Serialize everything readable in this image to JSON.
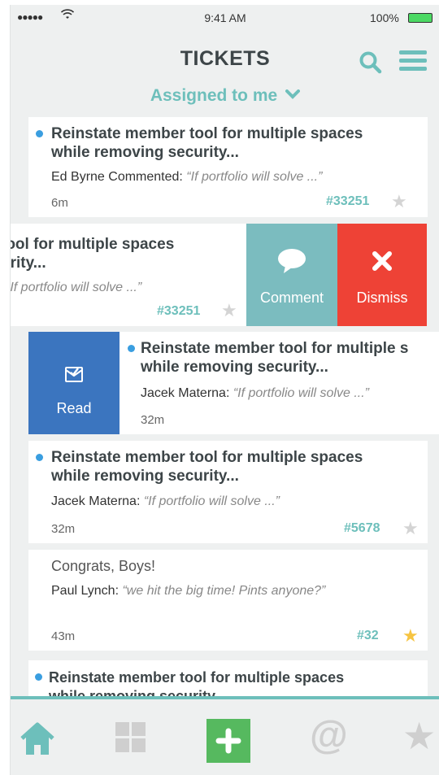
{
  "status_bar": {
    "signal": "●●●●●",
    "time": "9:41 AM",
    "battery_pct": "100%"
  },
  "header": {
    "title": "TICKETS",
    "filter": "Assigned to me"
  },
  "tickets": [
    {
      "subject_line1": "Reinstate member tool for multiple spaces",
      "subject_line2": "while removing security...",
      "author": "Ed Byrne Commented: ",
      "quote": "“If portfolio will solve ...”",
      "age": "6m",
      "number": "#33251",
      "starred": false
    },
    {
      "subject_line1": "tool for multiple spaces",
      "subject_line2": "urity...",
      "quote": "“If portfolio will solve ...”",
      "number": "#33251",
      "starred": false,
      "actions": {
        "comment": "Comment",
        "dismiss": "Dismiss"
      }
    },
    {
      "subject_line1": "Reinstate member tool for multiple s",
      "subject_line2": "while removing security...",
      "author": "Jacek Materna: ",
      "quote": "“If portfolio will solve ...”",
      "age": "32m",
      "actions": {
        "read": "Read"
      }
    },
    {
      "subject_line1": "Reinstate member tool for multiple spaces",
      "subject_line2": "while removing security...",
      "author": "Jacek Materna: ",
      "quote": "“If portfolio will solve ...”",
      "age": "32m",
      "number": "#5678",
      "starred": false
    },
    {
      "subject_line1": "Congrats, Boys!",
      "author": "Paul Lynch: ",
      "quote": "“we hit the big time! Pints anyone?”",
      "age": "43m",
      "number": "#32",
      "starred": true
    },
    {
      "subject_line1": "Reinstate member tool for multiple spaces",
      "subject_line2": "while removing security..."
    }
  ],
  "tabs": [
    "home-icon",
    "grid-icon",
    "add-icon",
    "mentions-icon",
    "star-icon"
  ],
  "tab_glyphs": {
    "mentions": "@",
    "star": "★",
    "ticket_star": "★"
  },
  "colors": {
    "accent": "#6dbfbb",
    "unread_dot": "#3a9ee0",
    "comment": "#7bbcbf",
    "dismiss": "#ee4236",
    "read": "#3b75bf",
    "add": "#56b95f",
    "star_on": "#f6c442"
  }
}
